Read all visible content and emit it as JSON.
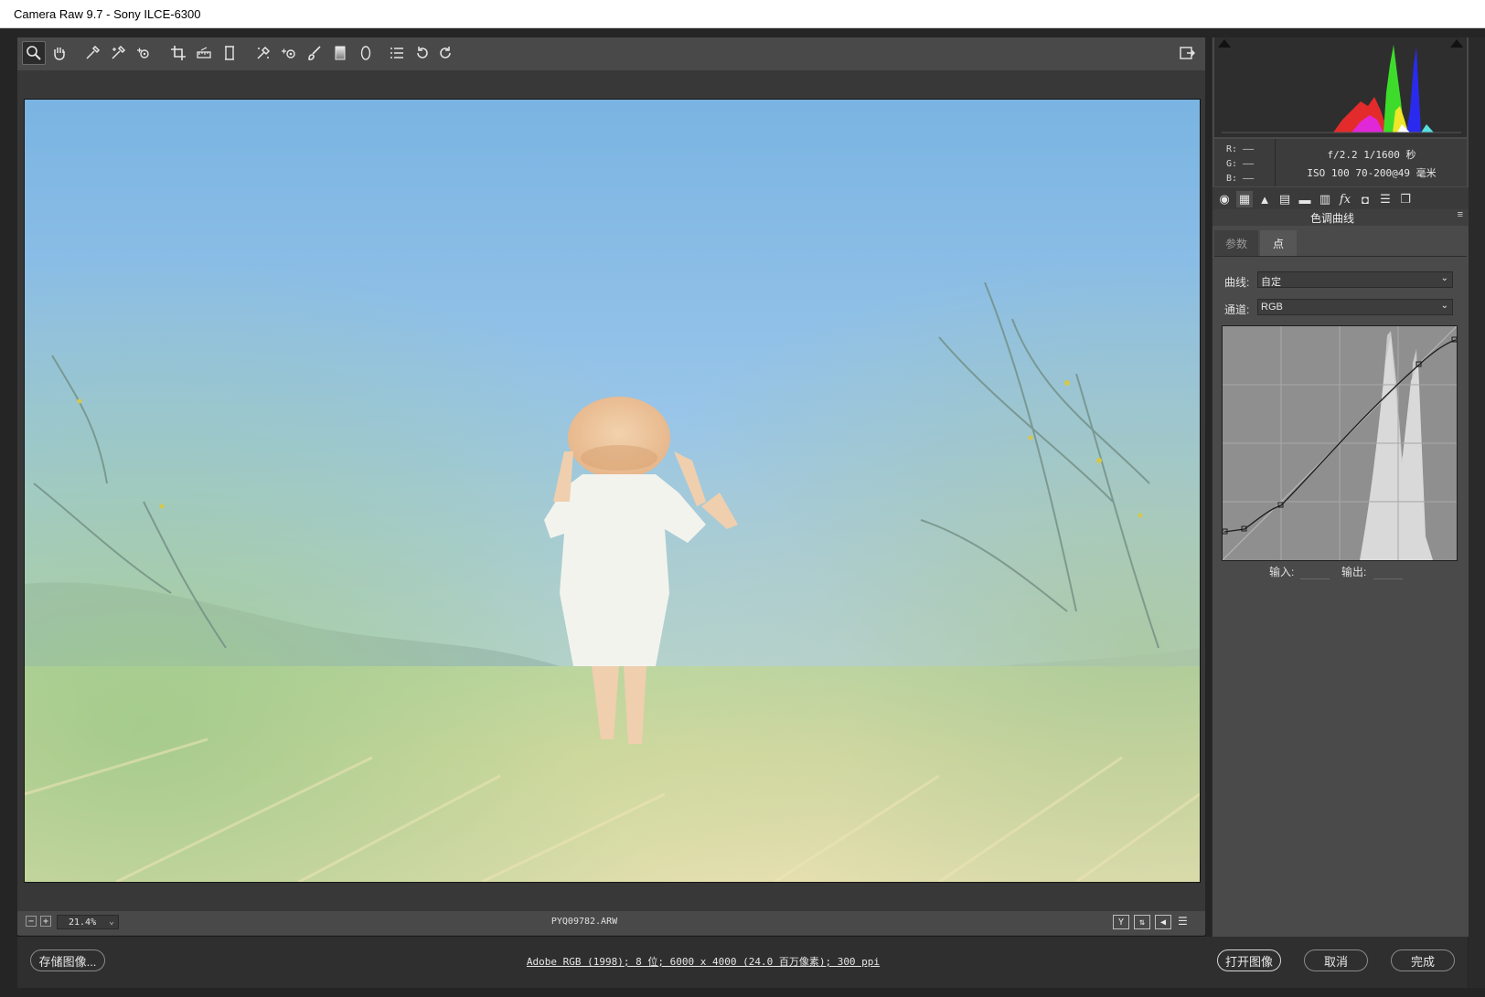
{
  "window": {
    "title": "Camera Raw 9.7 -  Sony ILCE-6300"
  },
  "toolbar": {
    "tools": [
      "zoom-icon",
      "hand-icon",
      "white-balance-icon",
      "color-sampler-icon",
      "target-adjust-icon",
      "crop-icon",
      "straighten-icon",
      "transform-icon",
      "spot-removal-icon",
      "red-eye-icon",
      "adjustment-brush-icon",
      "graduated-filter-icon",
      "radial-filter-icon",
      "preferences-icon",
      "rotate-left-icon",
      "rotate-right-icon"
    ],
    "fullscreen_icon": "fullscreen-icon"
  },
  "histogram": {
    "r_label": "R:",
    "g_label": "G:",
    "b_label": "B:",
    "r_value": "——",
    "g_value": "——",
    "b_value": "——",
    "exif_line1": "f/2.2  1/1600 秒",
    "exif_line2": "ISO 100  70-200@49 毫米"
  },
  "panel": {
    "icons": [
      "basic-icon",
      "tone-curve-icon",
      "detail-icon",
      "hsl-icon",
      "split-toning-icon",
      "lens-icon",
      "effects-icon",
      "camera-calibration-icon",
      "presets-icon",
      "snapshots-icon"
    ],
    "title": "色调曲线",
    "tabs": [
      {
        "label": "参数"
      },
      {
        "label": "点"
      }
    ],
    "curve_label": "曲线:",
    "curve_value": "自定",
    "channel_label": "通道:",
    "channel_value": "RGB",
    "input_label": "输入:",
    "output_label": "输出:"
  },
  "status": {
    "zoom": "21.4%",
    "filename": "PYQ09782.ARW"
  },
  "bottom": {
    "save_label": "存储图像...",
    "workflow_link": "Adobe RGB (1998); 8 位; 6000 x 4000 (24.0 百万像素); 300 ppi",
    "open_label": "打开图像",
    "cancel_label": "取消",
    "done_label": "完成"
  }
}
